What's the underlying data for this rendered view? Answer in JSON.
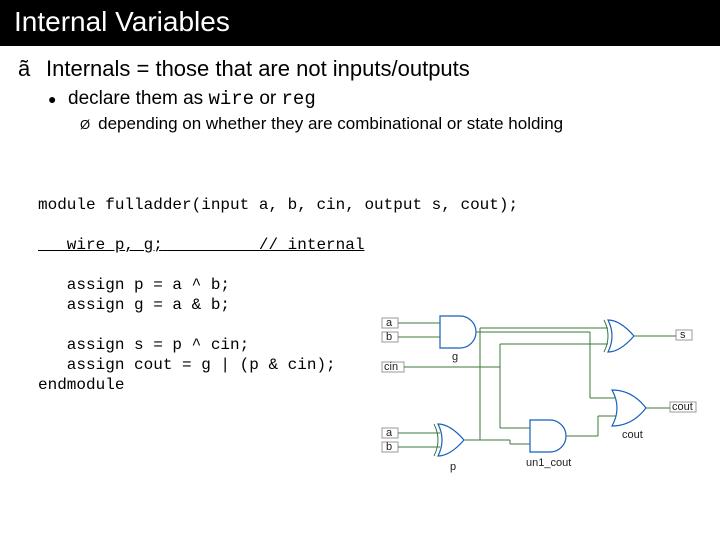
{
  "title": "Internal Variables",
  "bullets": {
    "top": "Internals = those that are not inputs/outputs",
    "sub_pre": "declare them as ",
    "sub_mono1": "wire",
    "sub_mid": " or ",
    "sub_mono2": "reg",
    "subsub": "depending on whether they are combinational or state holding"
  },
  "code": {
    "l1": "module fulladder(input a, b, cin, output s, cout);",
    "l2a": "   wire p, g;",
    "l2b": "          // internal",
    "l3": "   assign p = a ^ b;",
    "l4": "   assign g = a & b;",
    "l5": "   assign s = p ^ cin;",
    "l6": "   assign cout = g | (p & cin);",
    "l7": "endmodule"
  },
  "diagram": {
    "labels": {
      "a": "a",
      "b": "b",
      "cin": "cin",
      "g": "g",
      "p": "p",
      "s": "s",
      "un1_cout": "un1_cout",
      "cout": "cout"
    }
  }
}
